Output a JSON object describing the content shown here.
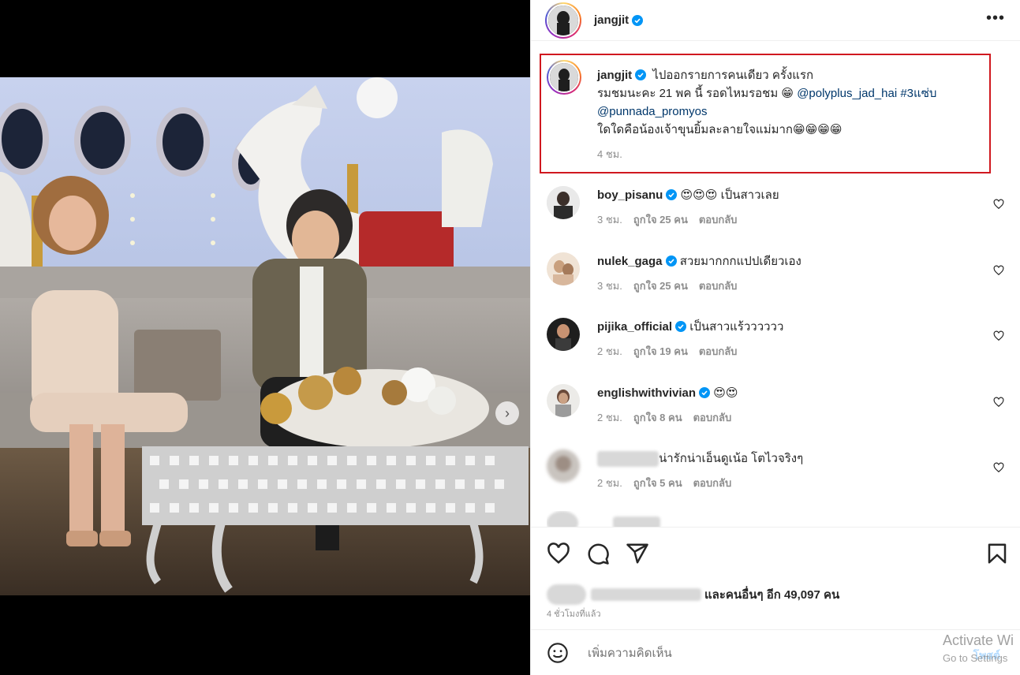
{
  "post": {
    "author": "jangjit",
    "caption_line1": "ไปออกรายการคนเดียว ครั้งแรก",
    "caption_line2": "รมชมนะคะ 21 พค นี้ รอดไหมรอชม 😁",
    "mention1": "@polyplus_jad_hai",
    "hashtag": "#3แซ่บ",
    "mention2": "@punnada_promyos",
    "caption_line3": "ใดใดคือน้องเจ้าขุนยิ้มละลายใจแม่มาก😁😁😁😁",
    "caption_time": "4 ชม."
  },
  "comments": [
    {
      "user": "boy_pisanu",
      "text": "😍😍😍 เป็นสาวเลย",
      "time": "3 ชม.",
      "likes": "ถูกใจ 25 คน",
      "reply": "ตอบกลับ"
    },
    {
      "user": "nulek_gaga",
      "text": "สวยมากกกแปปเดียวเอง",
      "time": "3 ชม.",
      "likes": "ถูกใจ 25 คน",
      "reply": "ตอบกลับ"
    },
    {
      "user": "pijika_official",
      "text": "เป็นสาวแร้วววววว",
      "time": "2 ชม.",
      "likes": "ถูกใจ 19 คน",
      "reply": "ตอบกลับ"
    },
    {
      "user": "englishwithvivian",
      "text": "😍😍",
      "time": "2 ชม.",
      "likes": "ถูกใจ 8 คน",
      "reply": "ตอบกลับ"
    },
    {
      "user": "",
      "text": "น่ารักน่าเอ็นดูเน้อ โตไวจริงๆ",
      "time": "2 ชม.",
      "likes": "ถูกใจ 5 คน",
      "reply": "ตอบกลับ"
    }
  ],
  "likes_text": "และคนอื่นๆ อีก 49,097 คน",
  "time_ago": "4 ชั่วโมงที่แล้ว",
  "add_comment_placeholder": "เพิ่มความคิดเห็น",
  "post_button": "โพสต์",
  "watermark": {
    "line1": "Activate Wi",
    "line2": "Go to Settings"
  },
  "icons": [
    "heart-icon",
    "comment-icon",
    "share-icon",
    "bookmark-icon",
    "emoji-icon",
    "more-icon",
    "verified-icon",
    "chevron-right-icon"
  ],
  "colors": {
    "highlight_border": "#d0181f",
    "verified": "#0095f6",
    "link": "#00376b"
  }
}
